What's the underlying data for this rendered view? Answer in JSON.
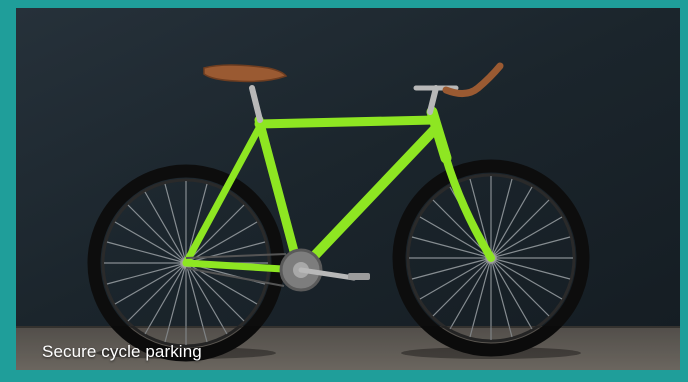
{
  "tile": {
    "caption": "Secure cycle parking",
    "image_subject": "green-fixie-bicycle-against-dark-wall"
  },
  "colors": {
    "frame_border": "#1f9e9a",
    "wall": "#1c262d",
    "ground": "#6b6660",
    "bike_frame": "#8ee622",
    "saddle": "#9a5a32",
    "tire": "#111111",
    "chrome": "#b8b8b8"
  }
}
